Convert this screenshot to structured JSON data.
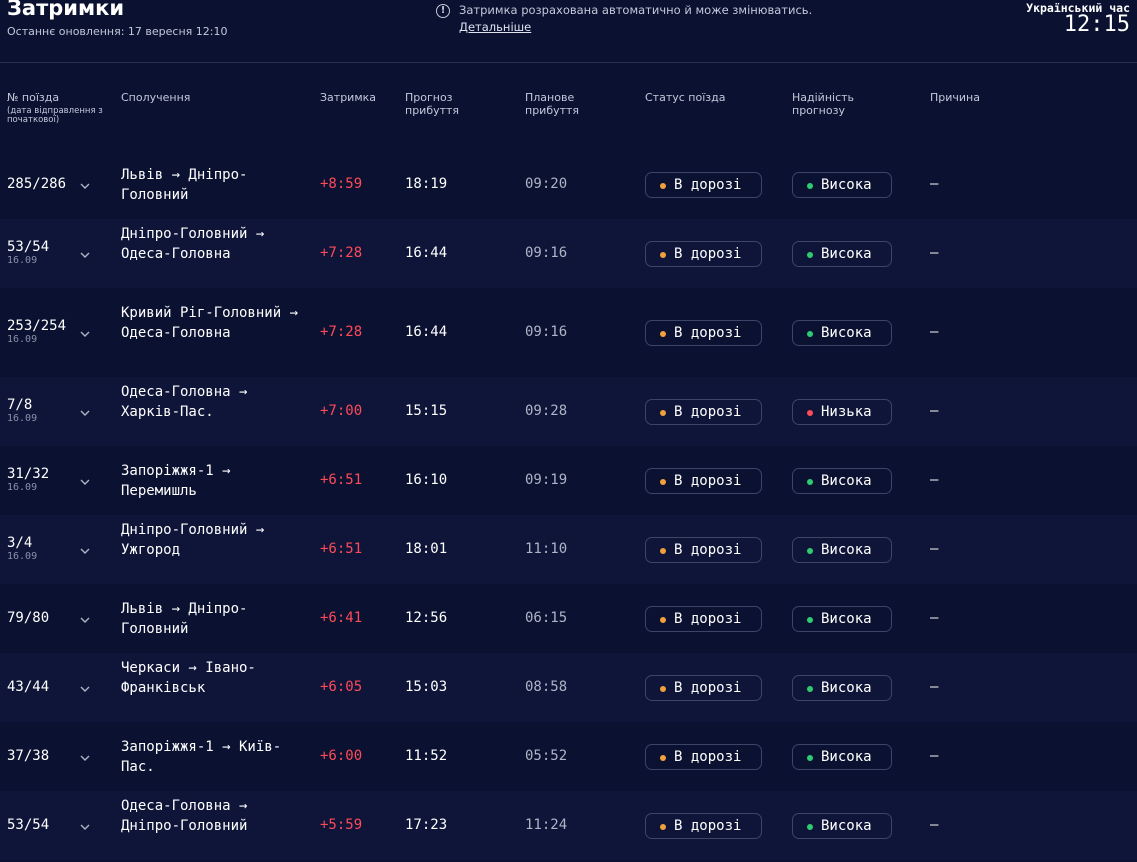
{
  "header": {
    "title": "Затримки",
    "subtitle": "Останнє оновлення: 17 вересня 12:10",
    "notice": "Затримка розрахована автоматично й може змінюватись.",
    "details_link": "Детальніше",
    "clock_label": "Український час",
    "clock_time": "12:15"
  },
  "columns": {
    "train_no": "№ поїзда",
    "train_no_sub": "(дата відправлення з початкової)",
    "route": "Сполучення",
    "delay": "Затримка",
    "forecast": "Прогноз прибуття",
    "planned": "Планове прибуття",
    "status": "Статус поїзда",
    "reliability": "Надійність прогнозу",
    "reason": "Причина"
  },
  "colors": {
    "status_dot": "#f2a03d",
    "high": "#2ecc71",
    "low": "#ff4a5a",
    "delay": "#ff4a5a"
  },
  "rows": [
    {
      "train": "285/286",
      "date": "",
      "route": "Львів → Дніпро-Головний",
      "delay": "+8:59",
      "forecast": "18:19",
      "planned": "09:20",
      "status": "В дорозі",
      "reliability": "Висока",
      "reason": "—"
    },
    {
      "train": "53/54",
      "date": "16.09",
      "route": "Дніпро-Головний → Одеса-Головна",
      "delay": "+7:28",
      "forecast": "16:44",
      "planned": "09:16",
      "status": "В дорозі",
      "reliability": "Висока",
      "reason": "—"
    },
    {
      "train": "253/254",
      "date": "16.09",
      "route": "Кривий Ріг-Головний → Одеса-Головна",
      "delay": "+7:28",
      "forecast": "16:44",
      "planned": "09:16",
      "status": "В дорозі",
      "reliability": "Висока",
      "reason": "—"
    },
    {
      "train": "7/8",
      "date": "16.09",
      "route": "Одеса-Головна → Харків-Пас.",
      "delay": "+7:00",
      "forecast": "15:15",
      "planned": "09:28",
      "status": "В дорозі",
      "reliability": "Низька",
      "reason": "—"
    },
    {
      "train": "31/32",
      "date": "16.09",
      "route": "Запоріжжя-1 → Перемишль",
      "delay": "+6:51",
      "forecast": "16:10",
      "planned": "09:19",
      "status": "В дорозі",
      "reliability": "Висока",
      "reason": "—"
    },
    {
      "train": "3/4",
      "date": "16.09",
      "route": "Дніпро-Головний → Ужгород",
      "delay": "+6:51",
      "forecast": "18:01",
      "planned": "11:10",
      "status": "В дорозі",
      "reliability": "Висока",
      "reason": "—"
    },
    {
      "train": "79/80",
      "date": "",
      "route": "Львів → Дніпро-Головний",
      "delay": "+6:41",
      "forecast": "12:56",
      "planned": "06:15",
      "status": "В дорозі",
      "reliability": "Висока",
      "reason": "—"
    },
    {
      "train": "43/44",
      "date": "",
      "route": "Черкаси → Івано-Франківськ",
      "delay": "+6:05",
      "forecast": "15:03",
      "planned": "08:58",
      "status": "В дорозі",
      "reliability": "Висока",
      "reason": "—"
    },
    {
      "train": "37/38",
      "date": "",
      "route": "Запоріжжя-1 → Київ-Пас.",
      "delay": "+6:00",
      "forecast": "11:52",
      "planned": "05:52",
      "status": "В дорозі",
      "reliability": "Висока",
      "reason": "—"
    },
    {
      "train": "53/54",
      "date": "",
      "route": "Одеса-Головна → Дніпро-Головний",
      "delay": "+5:59",
      "forecast": "17:23",
      "planned": "11:24",
      "status": "В дорозі",
      "reliability": "Висока",
      "reason": "—"
    }
  ]
}
